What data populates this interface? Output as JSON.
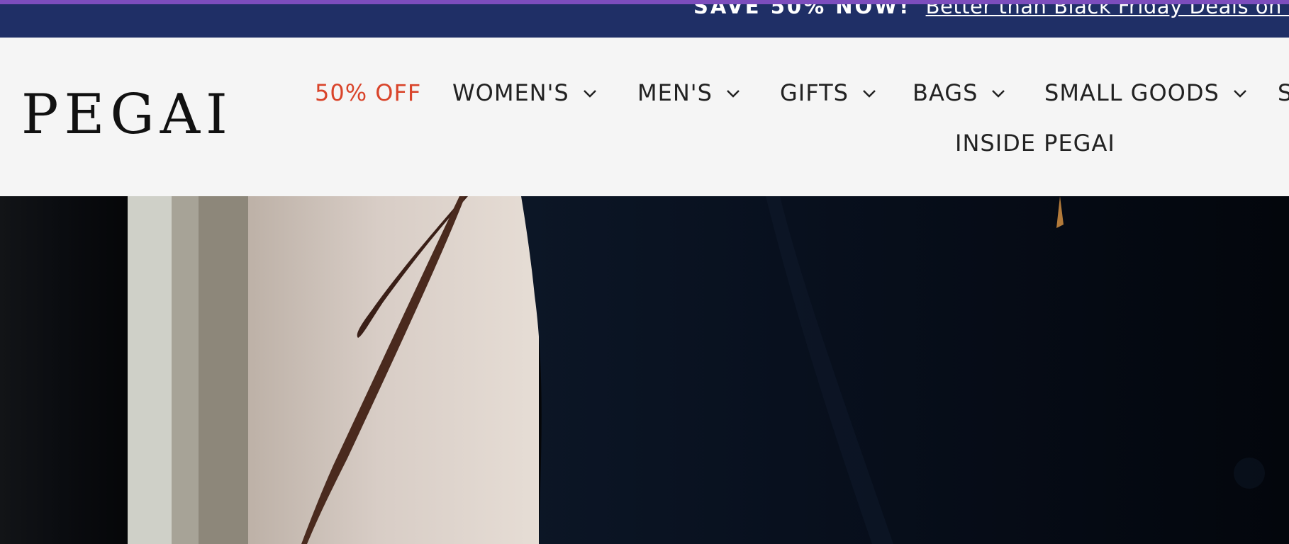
{
  "announcement": {
    "strong": "SAVE 50% NOW!",
    "link": "Better than Black Friday Deals on Select C"
  },
  "brand": {
    "logo": "PEGAI"
  },
  "nav": {
    "sale": "50% OFF",
    "womens": "WOMEN'S",
    "mens": "MEN'S",
    "gifts": "GIFTS",
    "bags": "BAGS",
    "small_goods": "SMALL GOODS",
    "cut_off": "S",
    "inside": "INSIDE PEGAI"
  },
  "icons": {
    "dropdown": "chevron-down-icon"
  },
  "colors": {
    "announcement_bg": "#1f2f66",
    "top_line": "#7c4dbd",
    "sale": "#d9442a",
    "header_bg": "#f5f5f5"
  }
}
